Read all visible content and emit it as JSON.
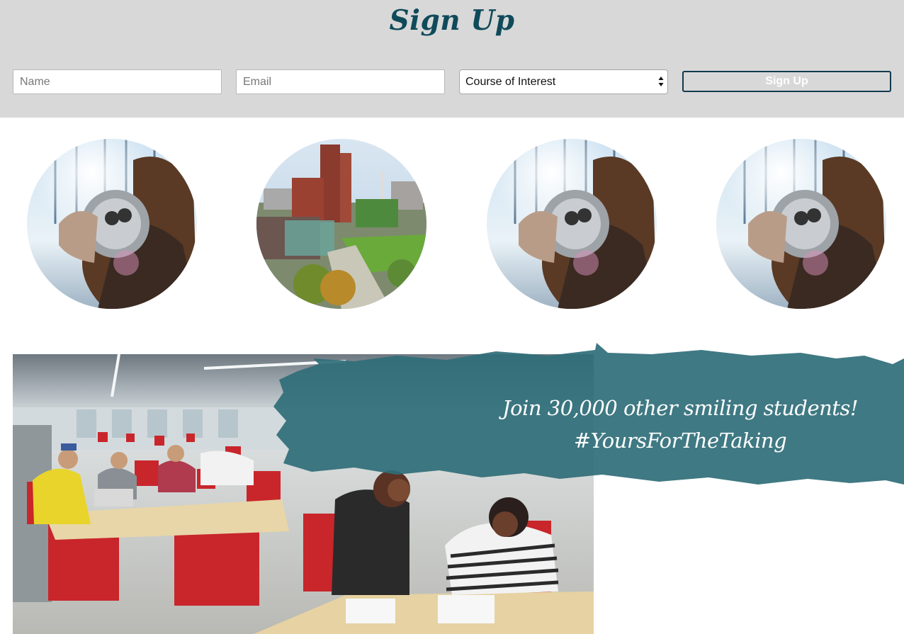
{
  "signup": {
    "title": "Sign Up",
    "name_placeholder": "Name",
    "email_placeholder": "Email",
    "course_selected": "Course of Interest",
    "button_label": "Sign Up"
  },
  "gallery": {
    "images": [
      {
        "subject": "woman-at-binoculars"
      },
      {
        "subject": "campus-aerial"
      },
      {
        "subject": "woman-at-binoculars"
      },
      {
        "subject": "woman-at-binoculars"
      }
    ]
  },
  "hero": {
    "line1": "Join 30,000 other smiling students!",
    "line2": "#YoursForTheTaking",
    "brush_color": "#2f6e78"
  },
  "colors": {
    "band_bg": "#d8d8d8",
    "title": "#0f4a5a",
    "button_border": "#123a4f"
  }
}
